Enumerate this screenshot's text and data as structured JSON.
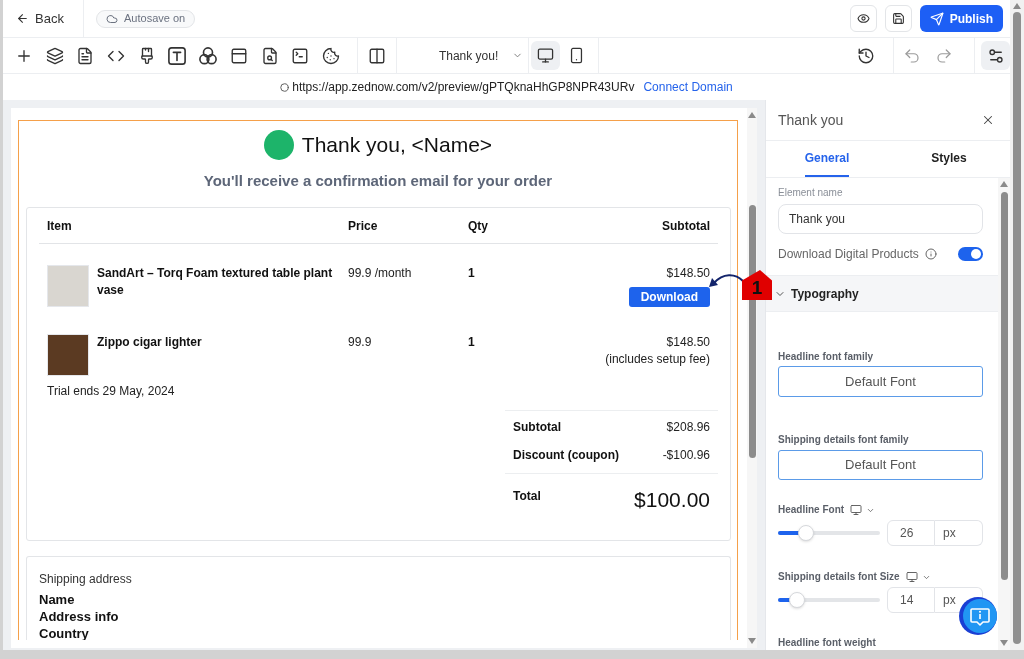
{
  "top_bar": {
    "back": "Back",
    "autosave": "Autosave on",
    "publish": "Publish"
  },
  "toolbar": {
    "page_select": "Thank you!",
    "devices": [
      {
        "kind": "desktop",
        "selected": true
      },
      {
        "kind": "mobile",
        "selected": false
      }
    ]
  },
  "address_bar": {
    "url": "https://app.zednow.com/v2/preview/gPTQknaHhGP8NPR43URv",
    "link": "Connect Domain"
  },
  "canvas": {
    "title": "Thank you, <Name>",
    "subtitle": "You'll receive a confirmation email for your order",
    "order": {
      "columns": [
        "Item",
        "Price",
        "Qty",
        "Subtotal"
      ],
      "rows": [
        {
          "item": "SandArt – Torq Foam textured table plant vase",
          "price": "99.9 /month",
          "qty": "1",
          "subtotal": "$148.50",
          "action": "Download"
        },
        {
          "item": "Zippo cigar lighter",
          "price": "99.9",
          "qty": "1",
          "subtotal": "$148.50",
          "note": "(includes setup fee)"
        }
      ],
      "trial_note": "Trial ends 29 May, 2024",
      "summary": [
        {
          "kind": "line",
          "label": "Subtotal",
          "value": "$208.96"
        },
        {
          "kind": "line",
          "label": "Discount (coupon)",
          "value": "-$100.96"
        },
        {
          "kind": "total",
          "label": "Total",
          "value": "$100.00"
        }
      ]
    },
    "shipping": {
      "title": "Shipping address",
      "lines": [
        "Name",
        "Address info",
        "Country"
      ]
    }
  },
  "annotation": {
    "number": "1"
  },
  "panel": {
    "title": "Thank you",
    "tabs": [
      {
        "label": "General",
        "selected": true
      },
      {
        "label": "Styles",
        "selected": false
      }
    ],
    "element_name": {
      "label": "Element name",
      "value": "Thank you"
    },
    "download_toggle": {
      "label": "Download Digital Products",
      "on": true
    },
    "typography": {
      "label": "Typography",
      "expanded": true,
      "font_families": [
        {
          "label": "Headline font family",
          "value": "Default Font"
        },
        {
          "label": "Shipping details font family",
          "value": "Default Font"
        }
      ],
      "sizes": [
        {
          "label": "Headline Font",
          "level": 0.27,
          "value": "26",
          "unit": "px"
        },
        {
          "label": "Shipping details font Size",
          "level": 0.19,
          "value": "14",
          "unit": "px"
        }
      ],
      "next_label": "Headline font weight"
    }
  }
}
